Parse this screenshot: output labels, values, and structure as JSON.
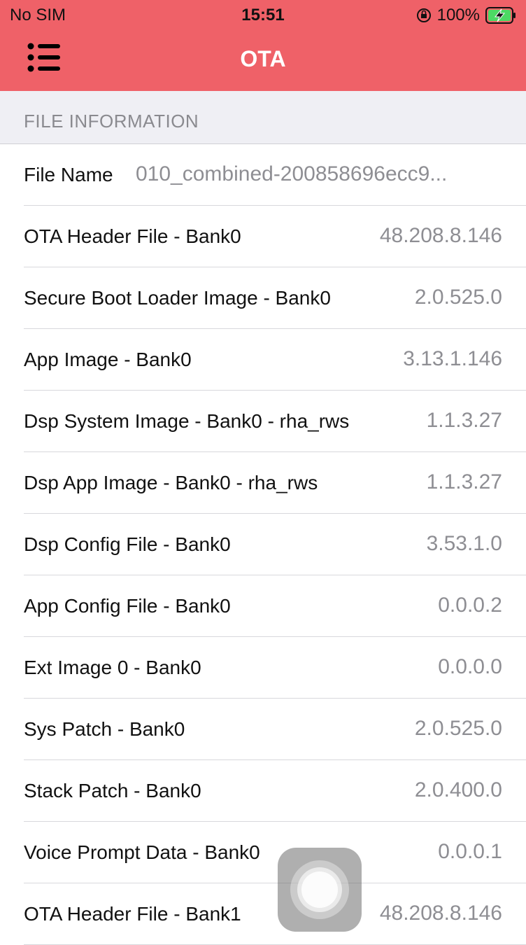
{
  "status_bar": {
    "carrier": "No SIM",
    "time": "15:51",
    "battery_percent": "100%",
    "icons": [
      "orientation-lock-icon",
      "battery-charging-icon"
    ]
  },
  "nav": {
    "title": "OTA",
    "menu_icon": "list-menu-icon",
    "background_color": "#ef6168"
  },
  "section": {
    "title": "FILE INFORMATION"
  },
  "rows": [
    {
      "label": "File Name",
      "value": "010_combined-200858696ecc9..."
    },
    {
      "label": "OTA Header File - Bank0",
      "value": "48.208.8.146"
    },
    {
      "label": "Secure Boot Loader Image - Bank0",
      "value": "2.0.525.0"
    },
    {
      "label": "App Image - Bank0",
      "value": "3.13.1.146"
    },
    {
      "label": "Dsp System Image - Bank0 - rha_rws",
      "value": "1.1.3.27"
    },
    {
      "label": "Dsp App Image - Bank0 - rha_rws",
      "value": "1.1.3.27"
    },
    {
      "label": "Dsp Config File - Bank0",
      "value": "3.53.1.0"
    },
    {
      "label": "App Config File - Bank0",
      "value": "0.0.0.2"
    },
    {
      "label": "Ext Image 0 - Bank0",
      "value": "0.0.0.0"
    },
    {
      "label": "Sys Patch - Bank0",
      "value": "2.0.525.0"
    },
    {
      "label": "Stack Patch - Bank0",
      "value": "2.0.400.0"
    },
    {
      "label": "Voice Prompt Data - Bank0",
      "value": "0.0.0.1"
    },
    {
      "label": "OTA Header File - Bank1",
      "value": "48.208.8.146"
    }
  ],
  "assistive_touch": {
    "icon": "assistive-touch-icon"
  }
}
